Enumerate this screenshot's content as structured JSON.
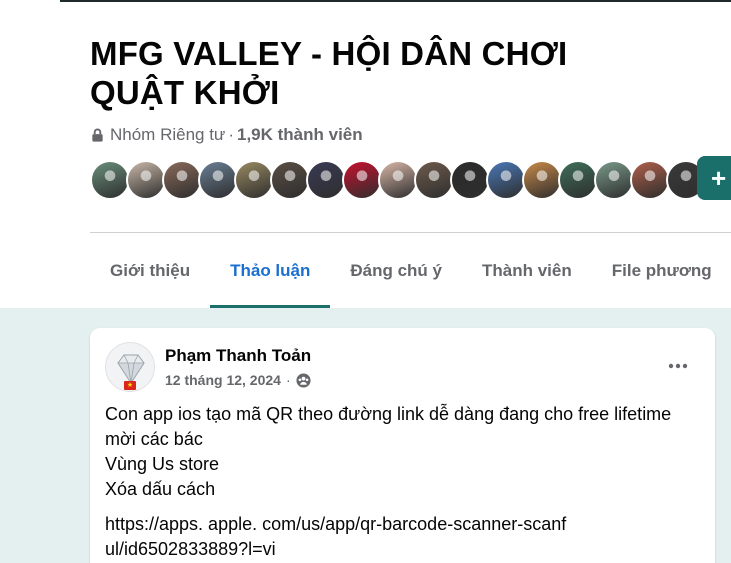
{
  "group": {
    "title": "MFG VALLEY - HỘI DÂN CHƠI QUẬT KHỞI",
    "privacy": "Nhóm Riêng tư",
    "separator": "·",
    "members": "1,9K thành viên"
  },
  "member_avatars": [
    {
      "icon": "member-avatar",
      "color": "#6a8f7a"
    },
    {
      "icon": "member-avatar",
      "color": "#c9b8a8"
    },
    {
      "icon": "member-avatar",
      "color": "#8a6a5a"
    },
    {
      "icon": "member-avatar",
      "color": "#6b7f96"
    },
    {
      "icon": "member-avatar",
      "color": "#9a8a62"
    },
    {
      "icon": "member-avatar",
      "color": "#5a4e44"
    },
    {
      "icon": "member-avatar",
      "color": "#3a3a55"
    },
    {
      "icon": "member-avatar",
      "color": "#c8102e"
    },
    {
      "icon": "member-avatar",
      "color": "#d9b7a8"
    },
    {
      "icon": "member-avatar",
      "color": "#6e5b4c"
    },
    {
      "icon": "member-avatar",
      "color": "#2b2b2b"
    },
    {
      "icon": "member-avatar",
      "color": "#4a78b8"
    },
    {
      "icon": "member-avatar",
      "color": "#c98a48"
    },
    {
      "icon": "member-avatar",
      "color": "#3f6f5a"
    },
    {
      "icon": "member-avatar",
      "color": "#7a9a8a"
    },
    {
      "icon": "member-avatar",
      "color": "#b0604a"
    },
    {
      "icon": "member-avatar",
      "color": "#3a3a3a"
    }
  ],
  "join_button": {
    "label": "+",
    "icon": "plus-icon",
    "color": "#1b6f6b"
  },
  "tabs": [
    {
      "label": "Giới thiệu",
      "active": false
    },
    {
      "label": "Thảo luận",
      "active": true
    },
    {
      "label": "Đáng chú ý",
      "active": false
    },
    {
      "label": "Thành viên",
      "active": false
    },
    {
      "label": "File phương",
      "active": false
    }
  ],
  "post": {
    "author": "Phạm Thanh Toản",
    "date": "12 tháng 12, 2024",
    "separator": "·",
    "audience_icon": "group-audience-icon",
    "more_icon": "more-options-icon",
    "body": [
      "Con app ios tạo mã QR theo đường link dễ dàng đang cho free lifetime mời các bác",
      "Vùng Us store",
      "Xóa dấu cách"
    ],
    "link": "https://apps. apple. com/us/app/qr-barcode-scanner-scanful/id6502833889?l=vi"
  },
  "colors": {
    "accent": "#1b6f6b",
    "active_tab_text": "#1a6fd0",
    "feed_bg": "#e4f0f0",
    "muted_text": "#65676b"
  }
}
